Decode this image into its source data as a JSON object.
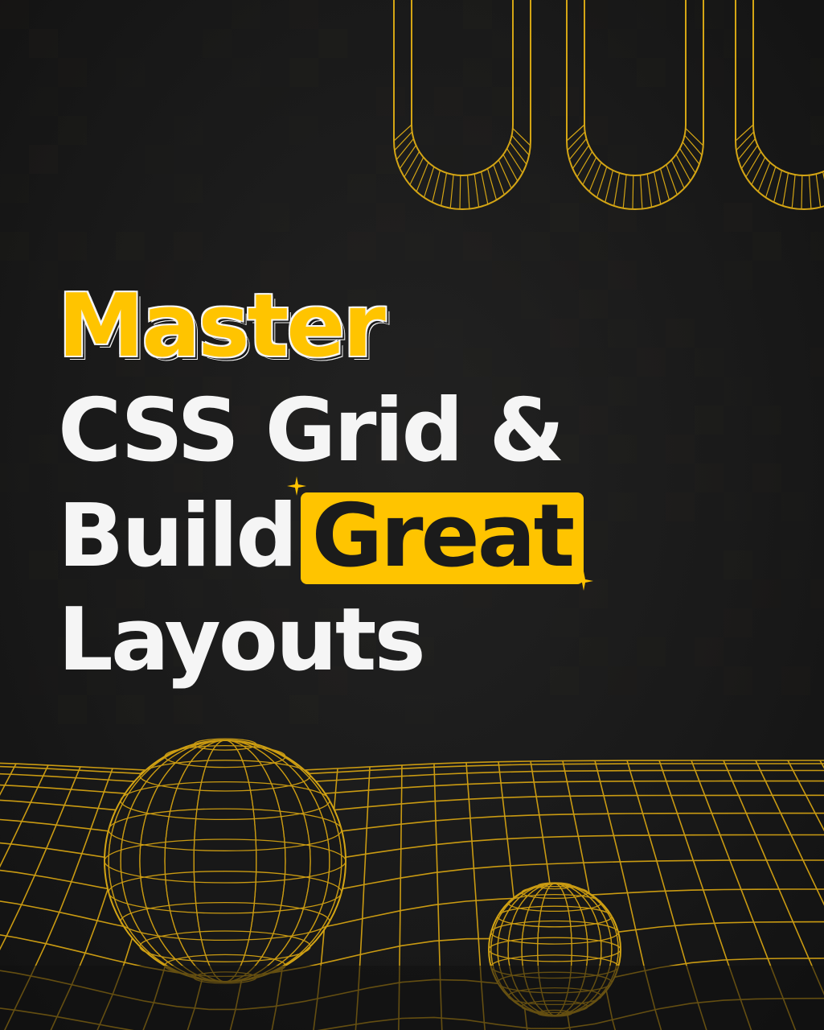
{
  "headline": {
    "line1": "Master",
    "line2": "CSS Grid &",
    "line3_prefix": "Build",
    "line3_highlight": "Great",
    "line4": "Layouts"
  },
  "colors": {
    "background": "#1a1a1a",
    "accent": "#ffc400",
    "text": "#f5f5f5",
    "highlight_text": "#1b1b1b"
  },
  "decor": {
    "top_shape": "wireframe-u-tubes",
    "bottom_shape": "wireframe-grid-floor-with-spheres",
    "sparkles": "four-point-star-icon"
  }
}
